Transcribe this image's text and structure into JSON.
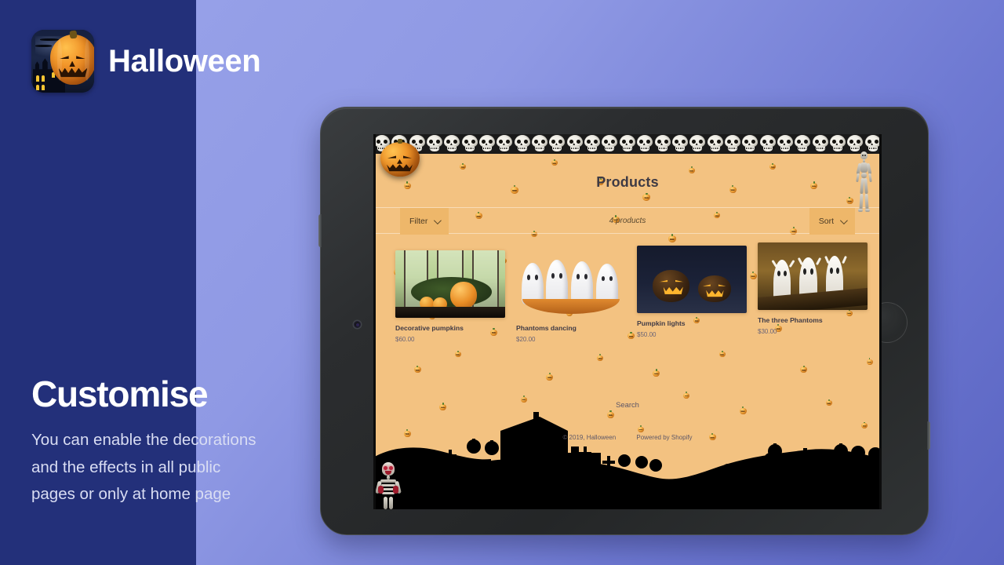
{
  "brand": {
    "title": "Halloween",
    "icon": "pumpkin-haunted-house-app-icon"
  },
  "promo": {
    "heading": "Customise",
    "body": "You can enable the decorations and the effects in all public pages or only at home page"
  },
  "device": {
    "type": "tablet",
    "camera": "front-camera",
    "home_button": "home-button"
  },
  "store": {
    "logo": "jack-o-lantern-logo",
    "decoration_top": "skull-border",
    "decoration_right": "hanging-skeleton",
    "page_title": "Products",
    "toolbar": {
      "filter_label": "Filter",
      "sort_label": "Sort",
      "count_label": "4 products",
      "chevron": "chevron-down-icon"
    },
    "products": [
      {
        "name": "Decorative pumpkins",
        "price": "$60.00",
        "image": "pumpkins-by-window"
      },
      {
        "name": "Phantoms dancing",
        "price": "$20.00",
        "image": "ghost-figurines-in-bowl"
      },
      {
        "name": "Pumpkin lights",
        "price": "$50.00",
        "image": "lit-jack-o-lanterns-night"
      },
      {
        "name": "The three Phantoms",
        "price": "$30.00",
        "image": "three-ghost-figures"
      }
    ],
    "footer": {
      "search_label": "Search",
      "copyright": "© 2019, Halloween",
      "powered_by": "Powered by Shopify"
    },
    "decoration_bottom": "graveyard-silhouette-with-zombie"
  },
  "colors": {
    "panel_navy": "#23307a",
    "bg_gradient_start": "#9aa4ea",
    "bg_gradient_end": "#5a64c2",
    "store_bg": "#f3c281",
    "chip_bg": "#eeb76a",
    "device_bezel": "#2b2d2f"
  }
}
